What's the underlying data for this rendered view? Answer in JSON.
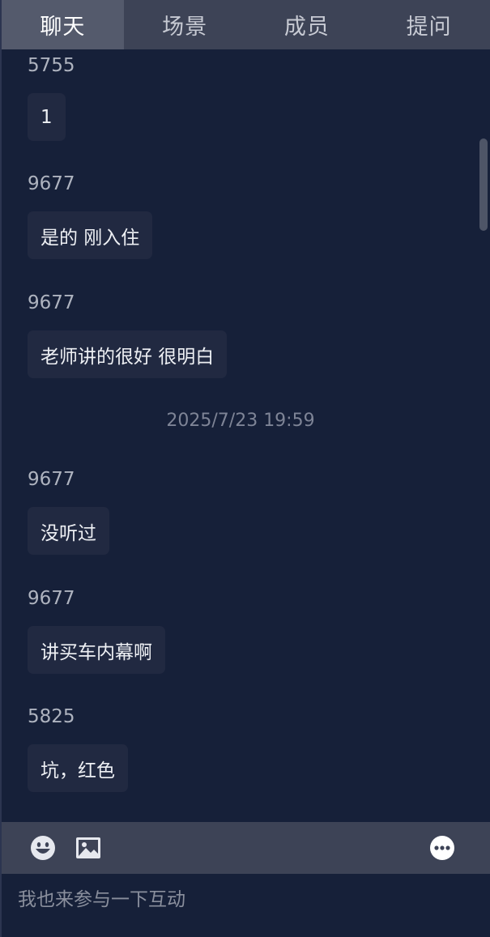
{
  "tabs": [
    {
      "label": "聊天",
      "active": true
    },
    {
      "label": "场景",
      "active": false
    },
    {
      "label": "成员",
      "active": false
    },
    {
      "label": "提问",
      "active": false
    }
  ],
  "messages": [
    {
      "sender": "5755",
      "text": "1"
    },
    {
      "sender": "9677",
      "text": "是的 刚入住"
    },
    {
      "sender": "9677",
      "text": "老师讲的很好 很明白"
    },
    {
      "timestamp": "2025/7/23 19:59"
    },
    {
      "sender": "9677",
      "text": "没听过"
    },
    {
      "sender": "9677",
      "text": "讲买车内幕啊"
    },
    {
      "sender": "5825",
      "text": "坑，红色"
    }
  ],
  "toolbar": {
    "icons": [
      "emoji-icon",
      "image-icon",
      "more-icon"
    ]
  },
  "input": {
    "placeholder": "我也来参与一下互动",
    "value": ""
  },
  "colors": {
    "background": "#162039",
    "tab_bar": "#3d4356",
    "tab_active": "#545a6c",
    "bubble": "#212941",
    "text": "#eef0f4",
    "sender": "#aeb3bf",
    "timestamp": "#7e8496"
  }
}
